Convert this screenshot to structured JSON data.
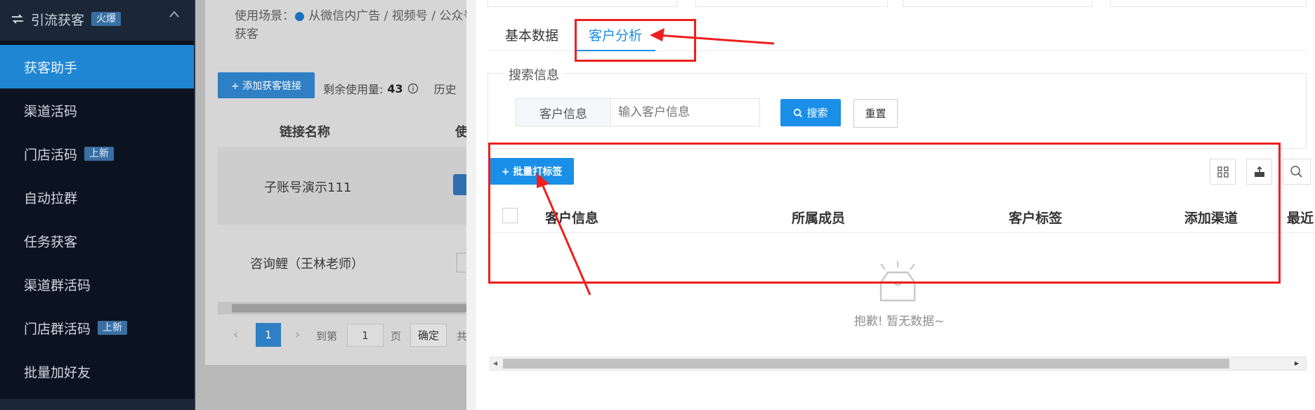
{
  "sidebar": {
    "group_title": "引流获客",
    "group_badge": "火爆",
    "items": [
      {
        "label": "获客助手",
        "active": true
      },
      {
        "label": "渠道活码"
      },
      {
        "label": "门店活码",
        "badge": "上新"
      },
      {
        "label": "自动拉群"
      },
      {
        "label": "任务获客"
      },
      {
        "label": "渠道群活码"
      },
      {
        "label": "门店群活码",
        "badge": "上新"
      },
      {
        "label": "批量加好友"
      }
    ]
  },
  "background_page": {
    "usage_label": "使用场景：",
    "usage_text": "从微信内广告 / 视频号 / 公众号",
    "usage_text2": "获客",
    "add_button": "+ 添加获客链接",
    "remaining_label": "剩余使用量:",
    "remaining_value": "43",
    "history_label": "历史",
    "col_link_name": "链接名称",
    "col_other": "使",
    "rows": [
      "子账号演示111",
      "咨询鲤（王林老师）"
    ],
    "pagination": {
      "current": "1",
      "goto_label": "到第",
      "goto_value": "1",
      "page_label": "页",
      "confirm": "确定",
      "total_prefix": "共"
    }
  },
  "panel": {
    "tabs": [
      {
        "label": "基本数据"
      },
      {
        "label": "客户分析",
        "active": true
      }
    ],
    "search_section_title": "搜索信息",
    "customer_info_label": "客户信息",
    "customer_info_placeholder": "输入客户信息",
    "search_button": "搜索",
    "reset_button": "重置",
    "batch_tag_button": "+ 批量打标签",
    "table_headers": [
      "客户信息",
      "所属成员",
      "客户标签",
      "添加渠道",
      "最近"
    ],
    "empty_text": "抱歉! 暂无数据~"
  },
  "colors": {
    "accent": "#1a8fe8",
    "annotation_red": "#ee1f1f",
    "sidebar_bg": "#0b1220"
  }
}
